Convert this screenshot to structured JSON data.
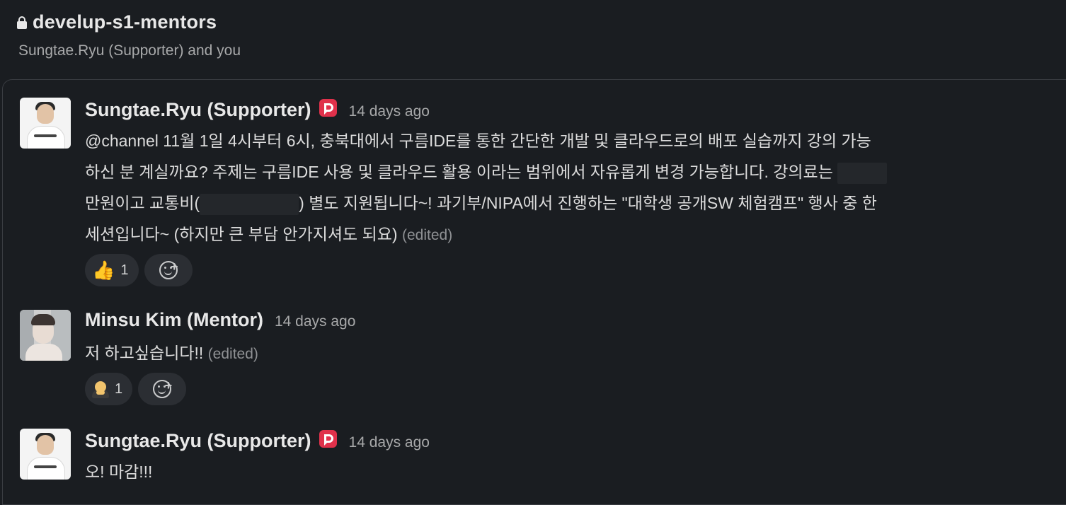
{
  "channel": {
    "name": "develup-s1-mentors",
    "members_text": "Sungtae.Ryu (Supporter) and you"
  },
  "messages": [
    {
      "author": "Sungtae.Ryu (Supporter)",
      "time": "14 days ago",
      "body_line1": "@channel 11월 1일 4시부터 6시, 충북대에서 구름IDE를 통한 간단한 개발 및 클라우드로의 배포 실습까지 강의 가능",
      "body_line2": "하신 분 계실까요? 주제는 구름IDE 사용 및 클라우드 활용 이라는 범위에서 자유롭게 변경 가능합니다. 강의료는 ",
      "body_line3a": "만원이고 교통비(",
      "body_line3b": ") 별도 지원됩니다~! 과기부/NIPA에서 진행하는 \"대학생 공개SW 체험캠프\" 행사 중 한",
      "body_line4": "세션입니다~ (하지만 큰 부담 안가지셔도 되요)",
      "edited": "(edited)",
      "reaction": {
        "emoji": "👍",
        "count": "1"
      }
    },
    {
      "author": "Minsu Kim (Mentor)",
      "time": "14 days ago",
      "body": "저 하고싶습니다!!",
      "edited": "(edited)",
      "reaction": {
        "emoji": "bowing-person",
        "count": "1"
      }
    },
    {
      "author": "Sungtae.Ryu (Supporter)",
      "time": "14 days ago",
      "body": "오! 마감!!!"
    }
  ],
  "icons": {
    "lock": "lock-icon",
    "badge": "goorm-badge-icon",
    "add_reaction": "add-reaction-icon"
  },
  "colors": {
    "background": "#1a1d21",
    "badge": "#e0314b",
    "reaction_bg": "#2b2e33"
  }
}
